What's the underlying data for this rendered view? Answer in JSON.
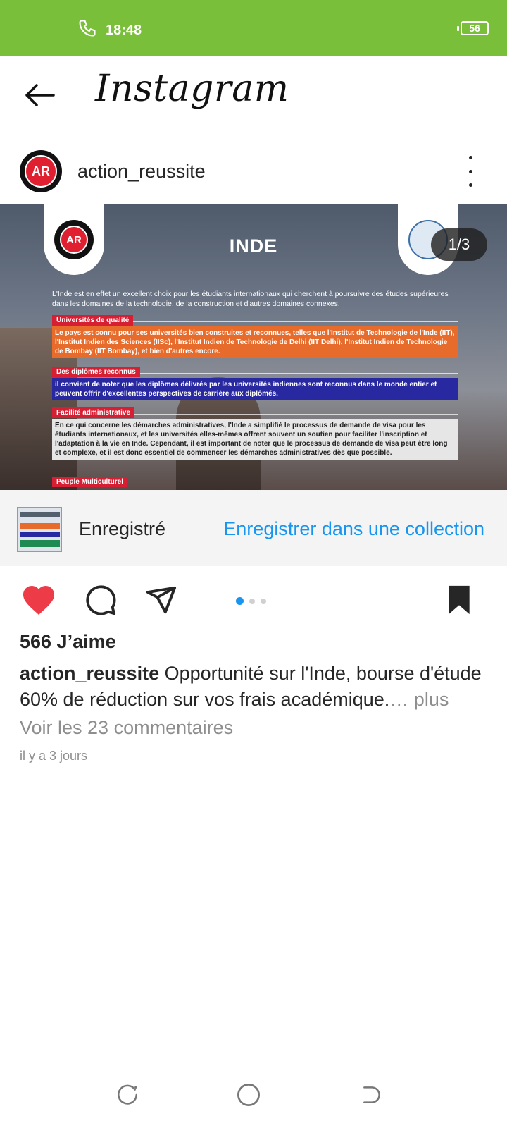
{
  "status": {
    "time": "18:48",
    "battery": "56"
  },
  "header": {
    "logo": "Instagram"
  },
  "post": {
    "username": "action_reussite",
    "counter": "1/3",
    "image": {
      "title": "INDE",
      "logo_initials": "AR",
      "intro": "L'Inde est en effet un excellent choix pour les étudiants internationaux qui cherchent à poursuivre des études supérieures dans les domaines de la technologie, de la construction et d'autres domaines connexes.",
      "sections": [
        {
          "title": "Universités de qualité",
          "body": "Le pays est connu pour ses universités bien construites et reconnues, telles que l'Institut de Technologie de l'Inde (IIT), l'Institut Indien des Sciences (IISc), l'Institut Indien de Technologie de Delhi (IIT Delhi), l'Institut Indien de Technologie de Bombay (IIT Bombay), et bien d'autres encore."
        },
        {
          "title": "Des diplômes reconnus",
          "body": "il convient de noter que les diplômes délivrés par les universités indiennes sont reconnus dans le monde entier et peuvent offrir d'excellentes perspectives de carrière aux diplômés."
        },
        {
          "title": "Facilité administrative",
          "body": "En ce qui concerne les démarches administratives, l'Inde a simplifié le processus de demande de visa pour les étudiants internationaux, et les universités elles-mêmes offrent souvent un soutien pour faciliter l'inscription et l'adaptation à la vie en Inde. Cependant, il est important de noter que le processus de demande de visa peut être long et complexe, et il est donc essentiel de commencer les démarches administratives dès que possible."
        },
        {
          "title": "Peuple Multiculturel",
          "body": ""
        }
      ]
    },
    "saved": {
      "label": "Enregistré",
      "link": "Enregistrer dans une collection"
    },
    "carousel": {
      "total": 3,
      "active": 1
    },
    "likes": "566 J’aime",
    "caption": {
      "user": "action_reussite",
      "text": " Opportunité sur l'Inde, bourse d'étude 60% de réduction sur vos frais académique.",
      "more": "… plus"
    },
    "comments": "Voir les 23 commentaires",
    "time": "il y a 3 jours"
  },
  "colors": {
    "status_bar": "#79bf3a",
    "like": "#ed3b48",
    "link": "#1795f0"
  }
}
